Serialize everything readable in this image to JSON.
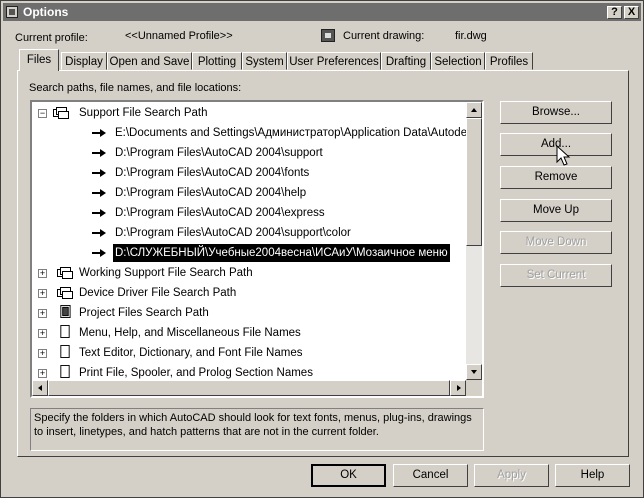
{
  "window": {
    "title": "Options",
    "help_btn": "?",
    "close_btn": "X"
  },
  "profile": {
    "label": "Current profile:",
    "value": "<<Unnamed Profile>>"
  },
  "drawing": {
    "label": "Current drawing:",
    "value": "fir.dwg"
  },
  "tabs": [
    {
      "label": "Files"
    },
    {
      "label": "Display"
    },
    {
      "label": "Open and Save"
    },
    {
      "label": "Plotting"
    },
    {
      "label": "System"
    },
    {
      "label": "User Preferences"
    },
    {
      "label": "Drafting"
    },
    {
      "label": "Selection"
    },
    {
      "label": "Profiles"
    }
  ],
  "active_tab": "Files",
  "tree": {
    "heading": "Search paths, file names, and file locations:",
    "expanded": {
      "label": "Support File Search Path",
      "expander": "−"
    },
    "paths": [
      {
        "label": "E:\\Documents and Settings\\Администратор\\Application Data\\Autodesk\\Au"
      },
      {
        "label": "D:\\Program Files\\AutoCAD 2004\\support"
      },
      {
        "label": "D:\\Program Files\\AutoCAD 2004\\fonts"
      },
      {
        "label": "D:\\Program Files\\AutoCAD 2004\\help"
      },
      {
        "label": "D:\\Program Files\\AutoCAD 2004\\express"
      },
      {
        "label": "D:\\Program Files\\AutoCAD 2004\\support\\color"
      },
      {
        "label": "D:\\СЛУЖЕБНЫЙ\\Учебные2004весна\\ИСАиУ\\Мозаичное меню"
      }
    ],
    "collapsed": [
      {
        "label": "Working Support File Search Path",
        "expander": "+",
        "icon": "folders-icon"
      },
      {
        "label": "Device Driver File Search Path",
        "expander": "+",
        "icon": "folders-icon"
      },
      {
        "label": "Project Files Search Path",
        "expander": "+",
        "icon": "project-icon"
      },
      {
        "label": "Menu, Help, and Miscellaneous File Names",
        "expander": "+",
        "icon": "file-icon"
      },
      {
        "label": "Text Editor, Dictionary, and Font File Names",
        "expander": "+",
        "icon": "file-icon"
      },
      {
        "label": "Print File, Spooler, and Prolog Section Names",
        "expander": "+",
        "icon": "file-icon"
      }
    ]
  },
  "side_buttons": {
    "browse": "Browse...",
    "add": "Add...",
    "remove": "Remove",
    "move_up": "Move Up",
    "move_down": "Move Down",
    "set_current": "Set Current"
  },
  "description": "Specify the folders in which AutoCAD should look for text fonts, menus, plug-ins, drawings to insert, linetypes, and hatch patterns that are not in the current folder.",
  "footer": {
    "ok": "OK",
    "cancel": "Cancel",
    "apply": "Apply",
    "help": "Help"
  }
}
